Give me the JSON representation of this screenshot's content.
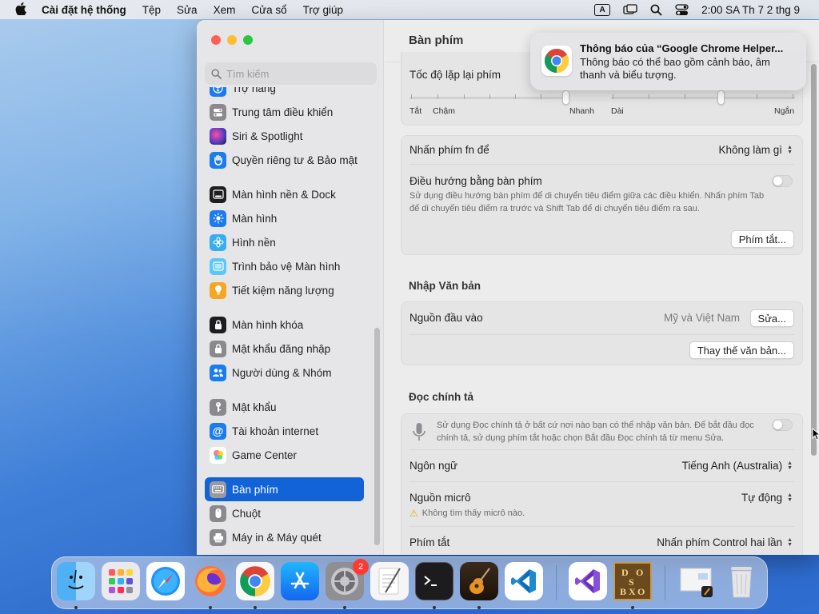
{
  "menubar": {
    "app": "Cài đặt hệ thống",
    "items": [
      "Tệp",
      "Sửa",
      "Xem",
      "Cửa sổ",
      "Trợ giúp"
    ],
    "input_source": "A",
    "clock": "2:00 SA Th 7 2 thg 9"
  },
  "sidebar": {
    "search_placeholder": "Tìm kiếm",
    "items": [
      {
        "label": "Trợ năng",
        "icon": "accessibility-icon",
        "color": "#1a7cf0"
      },
      {
        "label": "Trung tâm điều khiển",
        "icon": "control-center-icon",
        "color": "#8a8a8e"
      },
      {
        "label": "Siri & Spotlight",
        "icon": "siri-icon",
        "color": "#5b3cc4"
      },
      {
        "label": "Quyền riêng tư & Bảo mật",
        "icon": "privacy-hand-icon",
        "color": "#1a7cf0"
      },
      {
        "label": "Màn hình nền & Dock",
        "icon": "dock-icon",
        "color": "#1d1d1f"
      },
      {
        "label": "Màn hình",
        "icon": "display-icon",
        "color": "#1a7cf0"
      },
      {
        "label": "Hình nền",
        "icon": "wallpaper-icon",
        "color": "#38aef0"
      },
      {
        "label": "Trình bảo vệ Màn hình",
        "icon": "screensaver-icon",
        "color": "#5ac8fa"
      },
      {
        "label": "Tiết kiệm năng lượng",
        "icon": "bulb-icon",
        "color": "#f5a623"
      },
      {
        "label": "Màn hình khóa",
        "icon": "lock-screen-icon",
        "color": "#1d1d1f"
      },
      {
        "label": "Mật khẩu đăng nhập",
        "icon": "padlock-icon",
        "color": "#8a8a8e"
      },
      {
        "label": "Người dùng & Nhóm",
        "icon": "users-icon",
        "color": "#1a7cf0"
      },
      {
        "label": "Mật khẩu",
        "icon": "key-icon",
        "color": "#8a8a8e"
      },
      {
        "label": "Tài khoản internet",
        "icon": "at-icon",
        "color": "#1a7cf0"
      },
      {
        "label": "Game Center",
        "icon": "game-center-icon",
        "color": "#ffffff"
      },
      {
        "label": "Bàn phím",
        "icon": "keyboard-icon",
        "color": "#8a8a8e"
      },
      {
        "label": "Chuột",
        "icon": "mouse-icon",
        "color": "#8a8a8e"
      },
      {
        "label": "Máy in & Máy quét",
        "icon": "printer-icon",
        "color": "#8a8a8e"
      }
    ],
    "active_label": "Bàn phím"
  },
  "content": {
    "title": "Bàn phím",
    "key_repeat": {
      "label": "Tốc độ lặp lại phím",
      "slider1_labels": [
        "Tắt",
        "Chậm",
        "Nhanh"
      ],
      "slider2_labels": [
        "Dài",
        "Ngắn"
      ]
    },
    "fn_key": {
      "label": "Nhấn phím fn để",
      "value": "Không làm gì"
    },
    "keyboard_nav": {
      "label": "Điều hướng bằng bàn phím",
      "desc": "Sử dụng điều hướng bàn phím để di chuyển tiêu điểm giữa các điều khiển. Nhấn phím Tab để di chuyển tiêu điểm ra trước và Shift Tab để di chuyển tiêu điểm ra sau.",
      "shortcuts_button": "Phím tắt..."
    },
    "text_input": {
      "heading": "Nhập Văn bản",
      "source_label": "Nguồn đầu vào",
      "source_value": "Mỹ và Việt Nam",
      "edit_button": "Sửa...",
      "replace_button": "Thay thế văn bản..."
    },
    "dictation": {
      "heading": "Đọc chính tả",
      "desc": "Sử dụng Đọc chính tả ở bất cứ nơi nào bạn có thể nhập văn bản. Để bắt đầu đọc chính tả, sử dụng phím tắt hoặc chọn Bắt đầu Đọc chính tả từ menu Sửa.",
      "language_label": "Ngôn ngữ",
      "language_value": "Tiếng Anh (Australia)",
      "mic_label": "Nguồn micrô",
      "mic_value": "Tự động",
      "mic_warning": "Không tìm thấy micrô nào.",
      "shortcut_label": "Phím tắt",
      "shortcut_value": "Nhấn phím Control hai lần"
    }
  },
  "notification": {
    "title": "Thông báo của “Google Chrome Helper...",
    "body": "Thông báo có thể bao gồm cảnh báo, âm thanh và biểu tượng."
  },
  "dock": {
    "apps": [
      "finder-icon",
      "launchpad-icon",
      "safari-icon",
      "firefox-icon",
      "chrome-icon",
      "app-store-icon",
      "system-settings-icon",
      "textedit-icon",
      "terminal-icon",
      "garageband-icon",
      "vscode-icon",
      "visual-studio-icon",
      "dosbox-icon",
      "preview-icon",
      "trash-icon"
    ],
    "settings_badge": "2",
    "dosbox_letters": [
      "D",
      "O",
      "S",
      "B",
      "O",
      "X"
    ]
  }
}
